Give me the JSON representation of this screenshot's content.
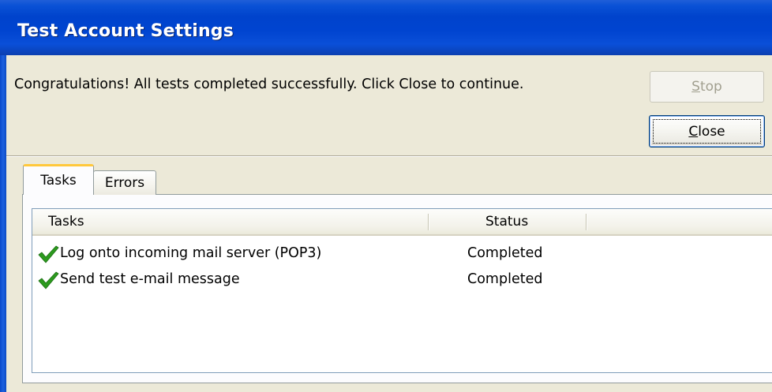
{
  "window": {
    "title": "Test Account Settings"
  },
  "message": "Congratulations! All tests completed successfully. Click Close to continue.",
  "buttons": {
    "stop": {
      "mnemonic": "S",
      "rest": "top",
      "enabled": false
    },
    "close": {
      "mnemonic": "C",
      "rest": "lose",
      "enabled": true
    }
  },
  "tabs": [
    {
      "label": "Tasks",
      "selected": true
    },
    {
      "label": "Errors",
      "selected": false
    }
  ],
  "list": {
    "columns": [
      "Tasks",
      "Status"
    ],
    "rows": [
      {
        "task": "Log onto incoming mail server (POP3)",
        "status": "Completed",
        "icon": "checkmark-icon"
      },
      {
        "task": "Send test e-mail message",
        "status": "Completed",
        "icon": "checkmark-icon"
      }
    ]
  },
  "colors": {
    "titlebar": "#0044d0",
    "dialog_bg": "#ece9d8",
    "check_green": "#2c9a1e",
    "tab_highlight": "#ffc83c"
  }
}
